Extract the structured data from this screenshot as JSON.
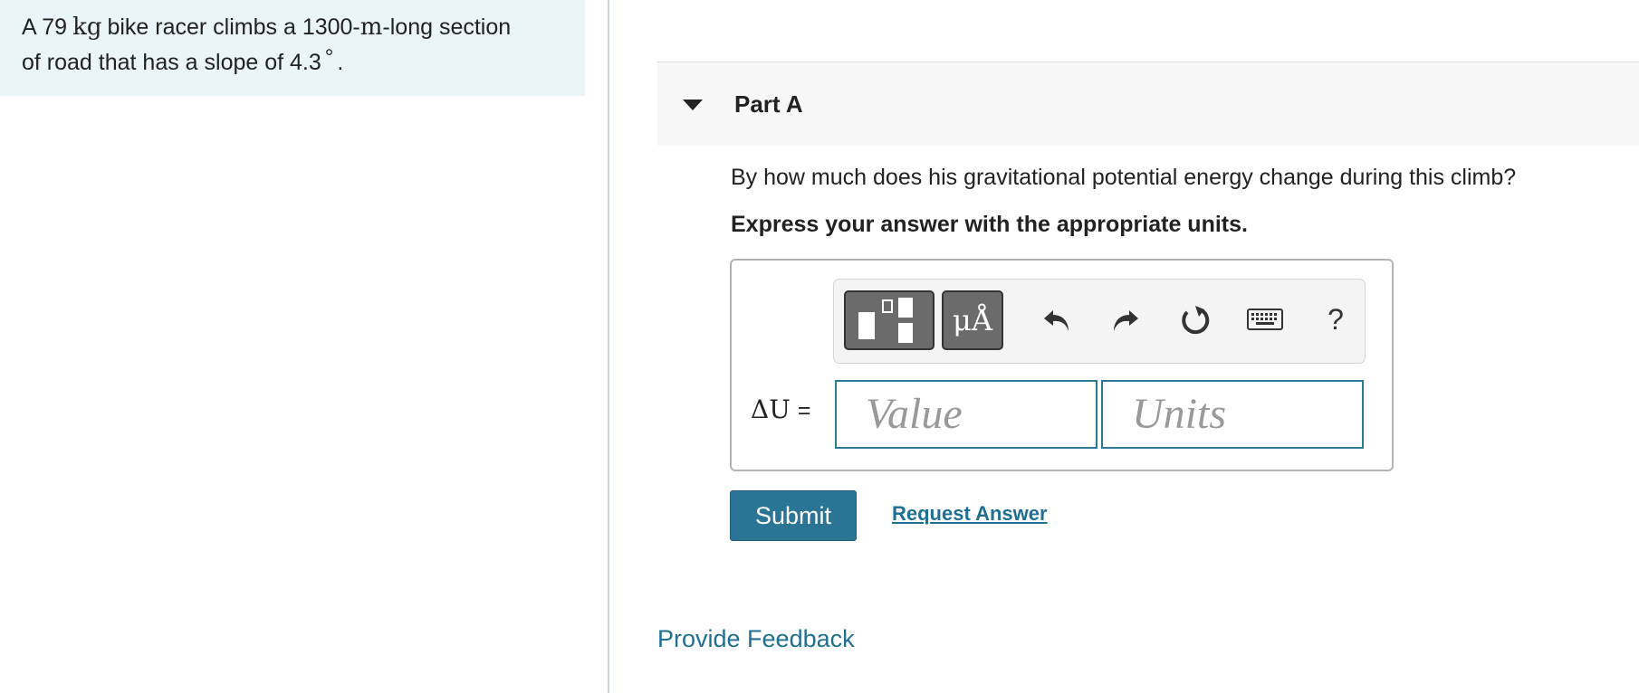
{
  "problem": {
    "prefix": "A 79",
    "mass_unit": "kg",
    "middle": "bike racer climbs a 1300-",
    "length_unit": "m",
    "suffix_line1": "-long section",
    "line2": "of road that has a slope of 4.3",
    "degree_symbol": "°",
    "end": "."
  },
  "part": {
    "title": "Part A",
    "question": "By how much does his gravitational potential energy change during this climb?",
    "instruction": "Express your answer with the appropriate units."
  },
  "toolbar": {
    "symbols_label": "μÅ",
    "help_label": "?"
  },
  "answer": {
    "lhs_symbol": "ΔU",
    "equals": "=",
    "value_placeholder": "Value",
    "units_placeholder": "Units"
  },
  "actions": {
    "submit_label": "Submit",
    "request_answer_label": "Request Answer",
    "feedback_label": "Provide Feedback"
  },
  "colors": {
    "accent": "#2a7495",
    "problem_background": "#e9f5f6"
  }
}
